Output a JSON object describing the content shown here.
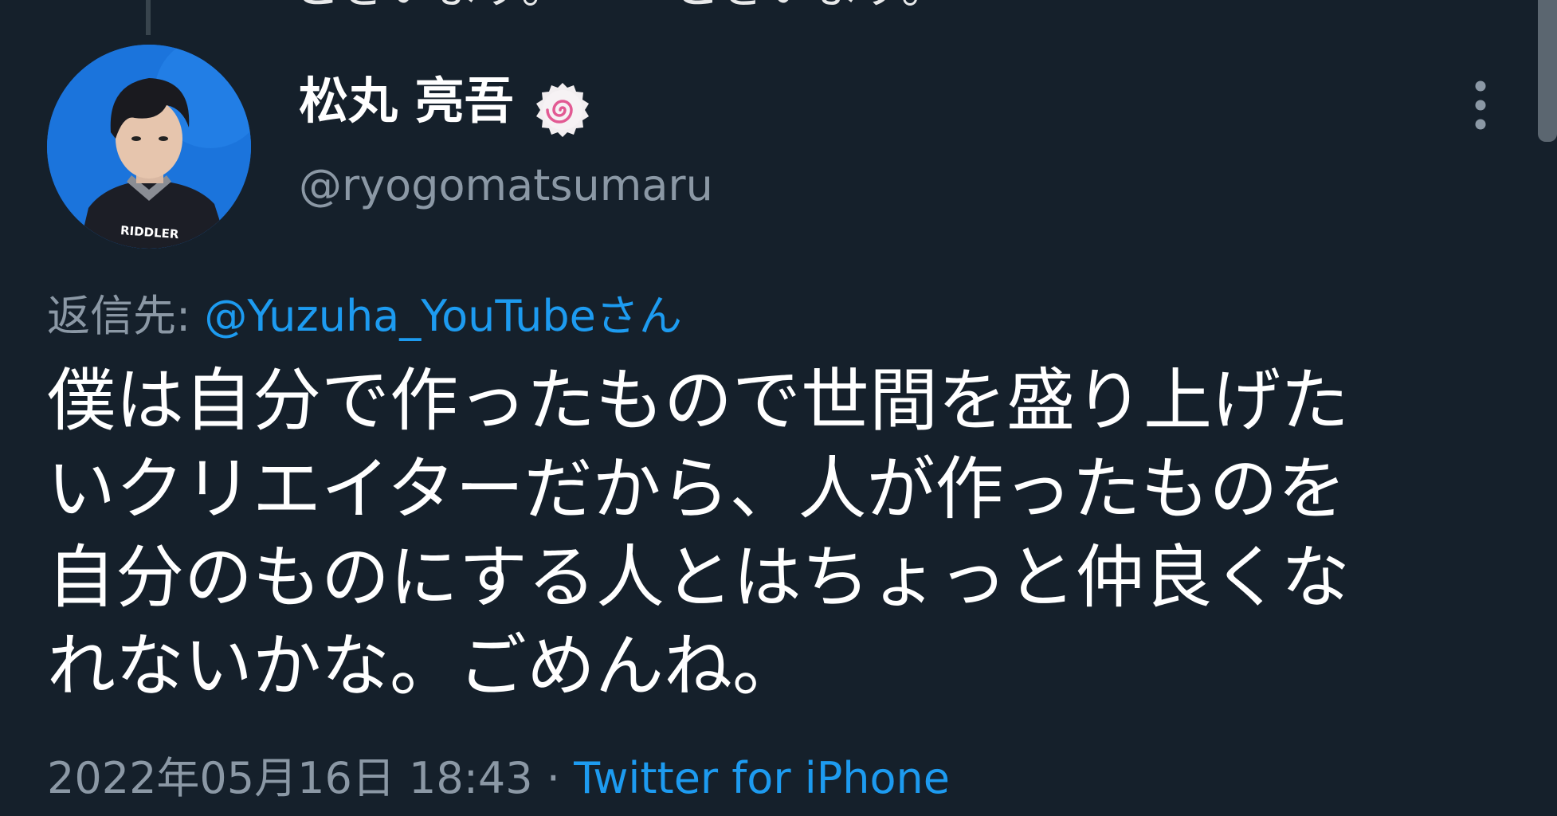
{
  "thread": {
    "previous_text_fragment": "ございます。ーー ございます。"
  },
  "author": {
    "display_name": "松丸 亮吾",
    "handle": "@ryogomatsumaru",
    "avatar_shirt_text": "RIDDLER",
    "badge_icon": "naruto-swirl-badge-icon"
  },
  "reply": {
    "label": "返信先: ",
    "to": "@Yuzuha_YouTubeさん"
  },
  "tweet": {
    "lines": [
      "僕は自分で作ったもので世間を盛り上げた",
      "いクリエイターだから、人が作ったものを",
      "自分のものにする人とはちょっと仲良くな",
      "れないかな。ごめんね。"
    ]
  },
  "meta": {
    "timestamp": "2022年05月16日 18:43",
    "separator": " · ",
    "source": "Twitter for iPhone"
  },
  "colors": {
    "background": "#15202b",
    "accent": "#1d9bf0",
    "secondary_text": "#8b98a5"
  }
}
